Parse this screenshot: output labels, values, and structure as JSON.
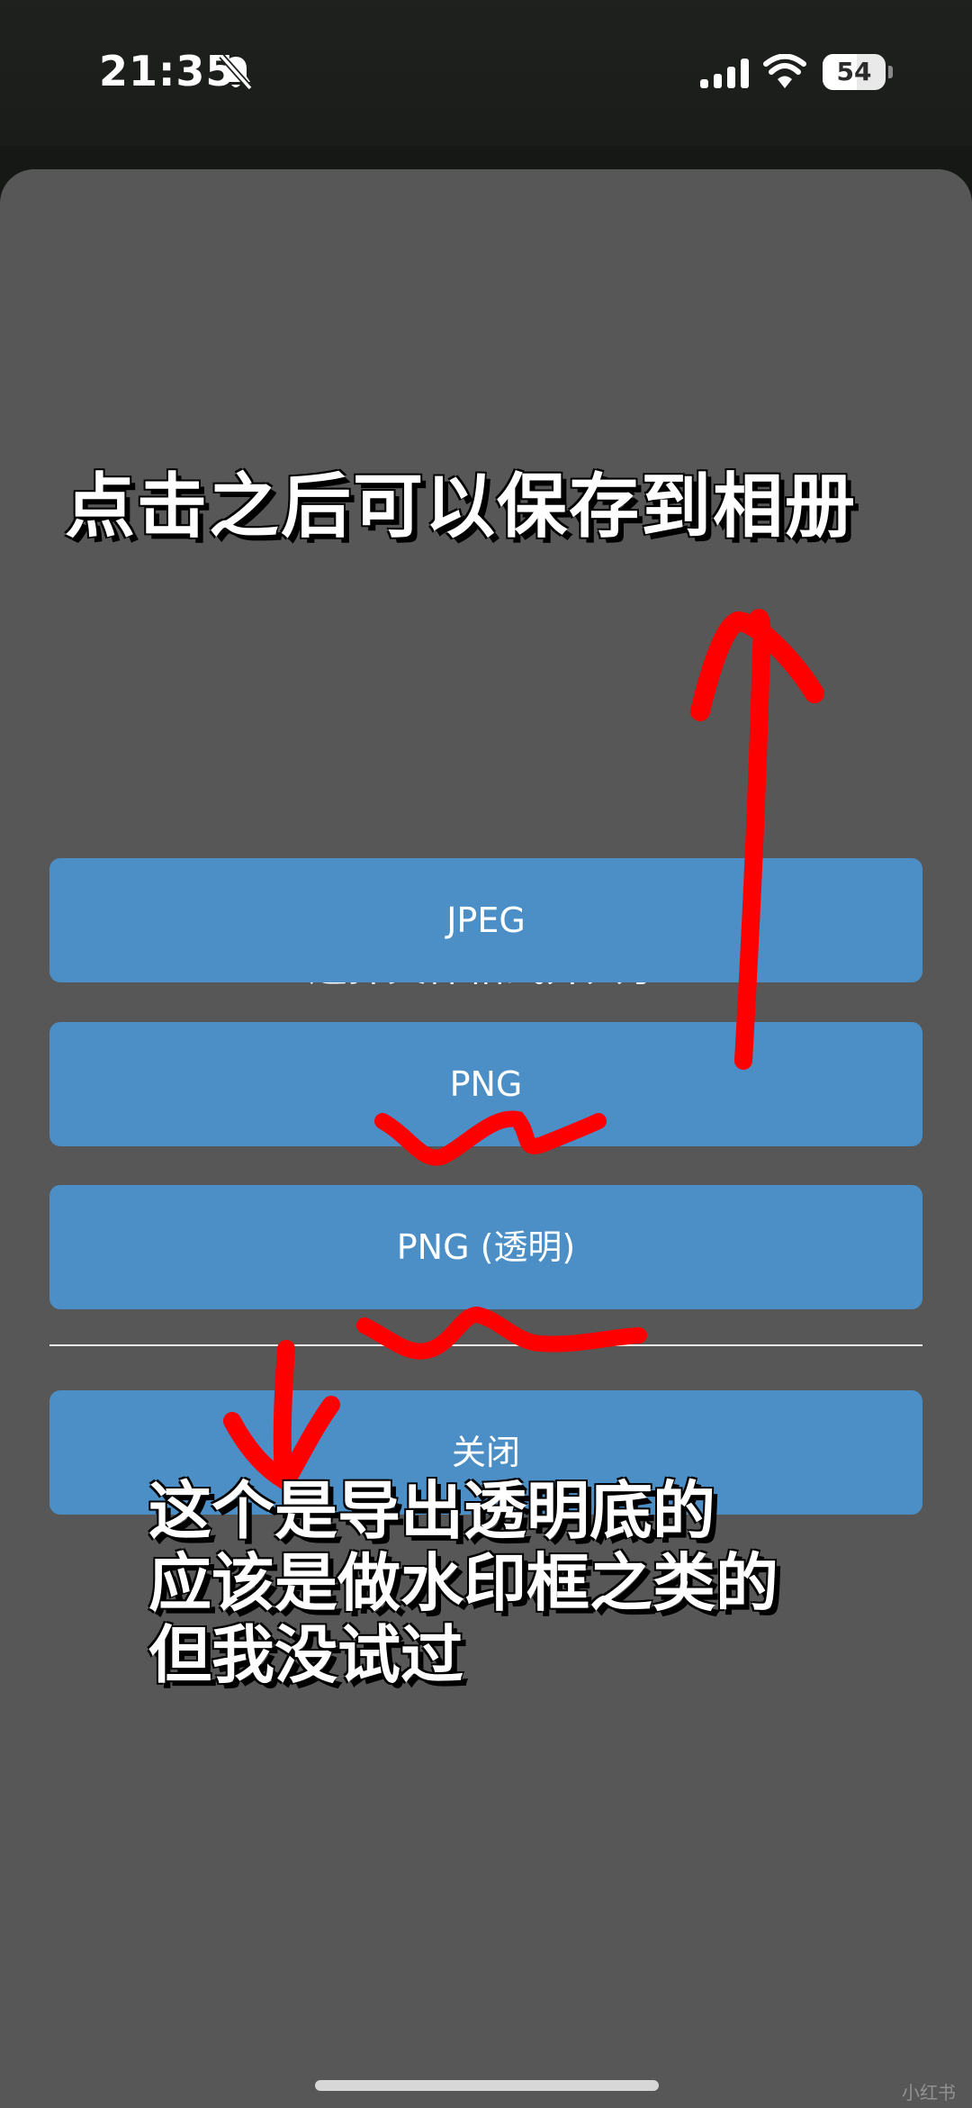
{
  "status_bar": {
    "time": "21:35",
    "battery_level": "54"
  },
  "sheet": {
    "title": "选择文件格式并共享",
    "buttons": {
      "jpeg": "JPEG",
      "png": "PNG",
      "png_transparent": "PNG (透明)",
      "close": "关闭"
    }
  },
  "annotations": {
    "top_note": "点击之后可以保存到相册",
    "bottom_note_lines": [
      "这个是导出透明底的",
      "应该是做水印框之类的",
      "但我没试过"
    ],
    "color": "#ff0000"
  },
  "watermark": "小红书",
  "icons": [
    "bell-off-icon",
    "signal-icon",
    "wifi-icon",
    "battery-icon"
  ]
}
